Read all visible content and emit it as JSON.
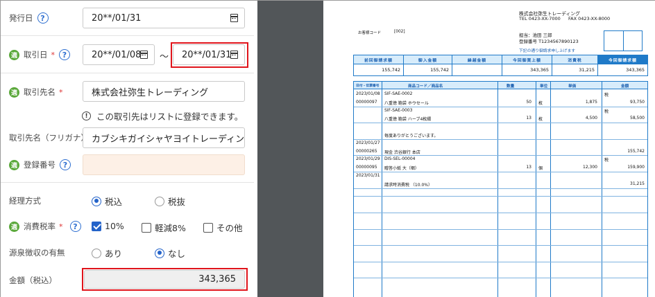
{
  "form": {
    "issue_date": {
      "label": "発行日",
      "value": "20**/01/31"
    },
    "transaction_date": {
      "label": "取引日",
      "required": "*",
      "from": "20**/01/08",
      "tilde": "〜",
      "to": "20**/01/31"
    },
    "partner": {
      "label": "取引先名",
      "required": "*",
      "value": "株式会社弥生トレーディング"
    },
    "notice": "この取引先はリストに登録できます。",
    "partner_kana": {
      "label": "取引先名（フリガナ）",
      "value": "カブシキガイシャヤヨイトレーディンク"
    },
    "registration_number": {
      "label": "登録番号",
      "value": ""
    },
    "tax_method": {
      "label": "経理方式",
      "options": [
        "税込",
        "税抜"
      ],
      "selected": "税込"
    },
    "tax_rate": {
      "label": "消費税率",
      "required": "*",
      "options": [
        "10%",
        "軽減8%",
        "その他"
      ],
      "checked": [
        "10%"
      ]
    },
    "withholding": {
      "label": "源泉徴収の有無",
      "options": [
        "あり",
        "なし"
      ],
      "selected": "なし"
    },
    "amount": {
      "label": "金額（税込）",
      "value": "343,365"
    },
    "badge_icon": "invoice-badge-icon",
    "colors": {
      "accent": "#2463c9",
      "highlight": "#e0141b",
      "badge": "#5aa83a",
      "disabled_field": "#fdf0e6"
    }
  },
  "doc": {
    "company": "株式会社弥生トレーディング",
    "tel": "TEL 0423-XX-7000",
    "fax": "FAX 0423-XX-8000",
    "customer_code_label": "お客様コード",
    "customer_code": "[002]",
    "person": "担当：池田 三郎",
    "reg_no": "登録番号 T1234567890123",
    "request_note": "下記の通り御請求申し上げます",
    "summary": [
      {
        "label": "前回御請求額",
        "value": "155,742"
      },
      {
        "label": "御入金額",
        "value": "155,742"
      },
      {
        "label": "繰越金額",
        "value": ""
      },
      {
        "label": "今回御買上額",
        "value": "343,365"
      },
      {
        "label": "消費税",
        "value": "31,215"
      },
      {
        "label": "今回御請求額",
        "value": "343,365"
      }
    ],
    "table_headers": {
      "date_no": "日付・伝票番号",
      "item": "商品コード／商品名",
      "qty": "数量",
      "unit": "単位",
      "price": "単価",
      "amount": "金額"
    },
    "rows": [
      {
        "date": "2023/01/08",
        "code": "SIF-SAE-0002",
        "name": "",
        "qty": "",
        "unit": "",
        "price": "",
        "amount": "",
        "mark": "税"
      },
      {
        "date": "00000097",
        "code": "",
        "name": "八重徳 鞄袋 ホウセール",
        "qty": "50",
        "unit": "枚",
        "price": "1,875",
        "amount": "93,750",
        "mark": ""
      },
      {
        "date": "",
        "code": "SIF-SAE-0003",
        "name": "",
        "qty": "",
        "unit": "",
        "price": "",
        "amount": "",
        "mark": "税"
      },
      {
        "date": "",
        "code": "",
        "name": "八重徳 鞄袋 ハーブ4枚綴",
        "qty": "13",
        "unit": "枚",
        "price": "4,500",
        "amount": "58,500",
        "mark": ""
      },
      {
        "date": "",
        "code": "",
        "name": "",
        "qty": "",
        "unit": "",
        "price": "",
        "amount": "",
        "mark": ""
      },
      {
        "date": "",
        "code": "",
        "name": "毎度ありがとうございます。",
        "qty": "",
        "unit": "",
        "price": "",
        "amount": "",
        "mark": ""
      },
      {
        "date": "2023/01/27",
        "code": "",
        "name": "",
        "qty": "",
        "unit": "",
        "price": "",
        "amount": "",
        "mark": ""
      },
      {
        "date": "00000265",
        "code": "",
        "name": "現金  渋谷銀行 本店",
        "qty": "",
        "unit": "",
        "price": "",
        "amount": "155,742",
        "mark": ""
      },
      {
        "date": "2023/01/29",
        "code": "DIS-SEL-00004",
        "name": "",
        "qty": "",
        "unit": "",
        "price": "",
        "amount": "",
        "mark": "税"
      },
      {
        "date": "00000095",
        "code": "",
        "name": "贈答小紙 大（梱）",
        "qty": "13",
        "unit": "個",
        "price": "12,300",
        "amount": "159,900",
        "mark": ""
      },
      {
        "date": "2023/01/31",
        "code": "",
        "name": "",
        "qty": "",
        "unit": "",
        "price": "",
        "amount": "",
        "mark": ""
      },
      {
        "date": "",
        "code": "",
        "name": "請求時消費税 （10.0%）",
        "qty": "",
        "unit": "",
        "price": "",
        "amount": "31,215",
        "mark": ""
      }
    ]
  }
}
